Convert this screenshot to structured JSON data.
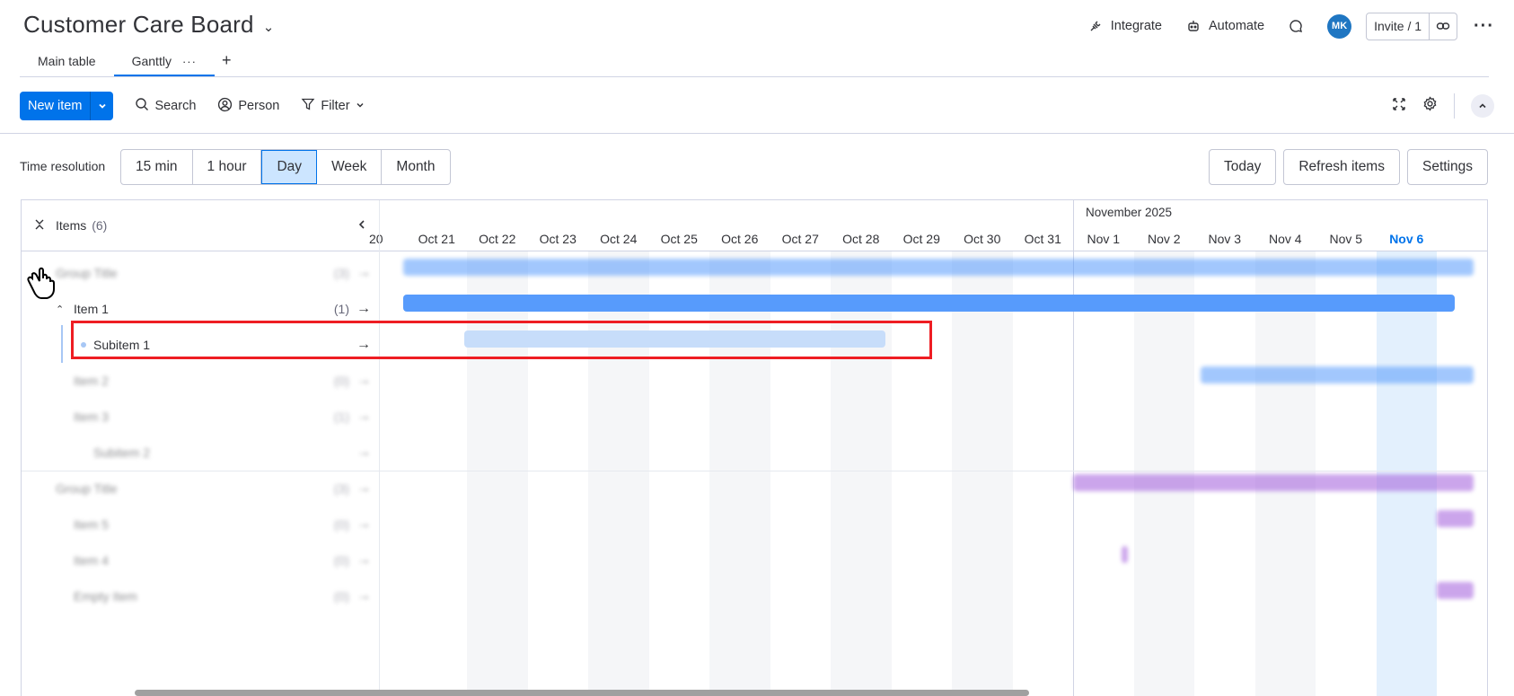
{
  "board": {
    "title": "Customer Care Board"
  },
  "header": {
    "integrate": "Integrate",
    "automate": "Automate",
    "avatar_initials": "MK",
    "invite": "Invite / 1"
  },
  "tabs": [
    {
      "label": "Main table"
    },
    {
      "label": "Ganttly"
    }
  ],
  "toolbar": {
    "new_item": "New item",
    "search": "Search",
    "person": "Person",
    "filter": "Filter"
  },
  "resolution": {
    "label": "Time resolution",
    "options": [
      "15 min",
      "1 hour",
      "Day",
      "Week",
      "Month"
    ],
    "selected": "Day"
  },
  "actions": {
    "today": "Today",
    "refresh": "Refresh items",
    "settings": "Settings"
  },
  "left_pane": {
    "header_label": "Items",
    "header_count": "(6)",
    "rows": [
      {
        "label": "Group Title",
        "count": "(3)",
        "blurred": true
      },
      {
        "label": "Item 1",
        "count": "(1)",
        "blurred": false
      },
      {
        "label": "Subitem 1",
        "count": "",
        "blurred": false
      },
      {
        "label": "Item 2",
        "count": "(0)",
        "blurred": true
      },
      {
        "label": "Item 3",
        "count": "(1)",
        "blurred": true
      },
      {
        "label": "Subitem 2",
        "count": "",
        "blurred": true
      },
      {
        "label": "Group Title",
        "count": "(3)",
        "blurred": true
      },
      {
        "label": "Item 5",
        "count": "(0)",
        "blurred": true
      },
      {
        "label": "Item 4",
        "count": "(0)",
        "blurred": true
      },
      {
        "label": "Empty Item",
        "count": "(0)",
        "blurred": true
      }
    ]
  },
  "timeline": {
    "month_label": "November 2025",
    "days": [
      "20",
      "Oct 21",
      "Oct 22",
      "Oct 23",
      "Oct 24",
      "Oct 25",
      "Oct 26",
      "Oct 27",
      "Oct 28",
      "Oct 29",
      "Oct 30",
      "Oct 31",
      "Nov 1",
      "Nov 2",
      "Nov 3",
      "Nov 4",
      "Nov 5",
      "Nov 6"
    ],
    "today": "Nov 6"
  },
  "colors": {
    "accent": "#0073ea",
    "bar_blue": "#579bfc",
    "bar_light": "#c7ddfa",
    "bar_purple": "#a25ddc",
    "highlight": "#ee1d23"
  }
}
